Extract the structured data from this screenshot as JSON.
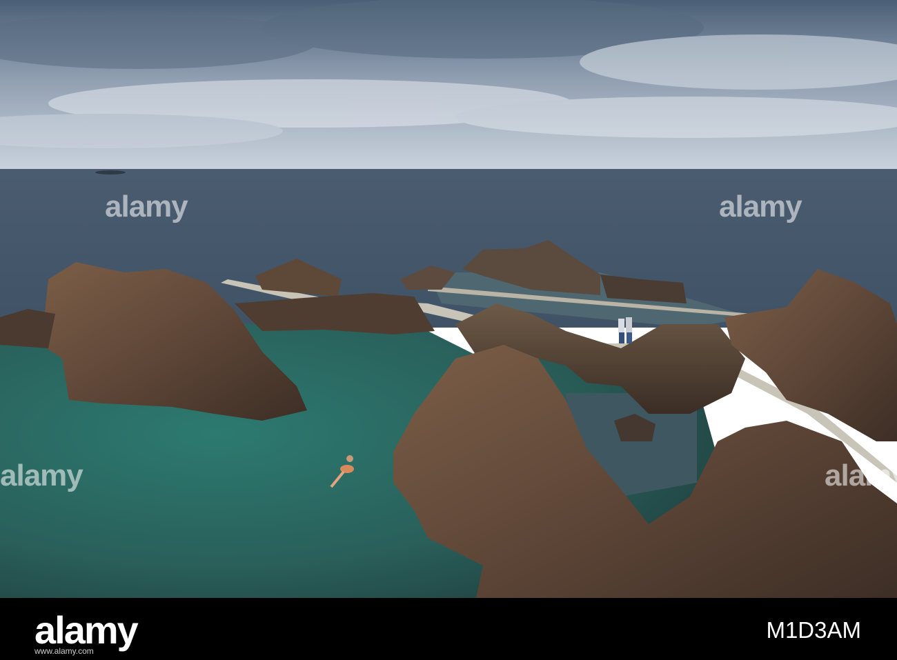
{
  "watermark": {
    "text": "alamy"
  },
  "footer": {
    "logo": "alamy",
    "image_id": "M1D3AM",
    "url": "www.alamy.com"
  },
  "colors": {
    "sky_top": "#4d6278",
    "ocean": "#4b5e72",
    "pool": "#2f6b66",
    "rock": "#6a5140",
    "footer_bg": "#000000"
  }
}
